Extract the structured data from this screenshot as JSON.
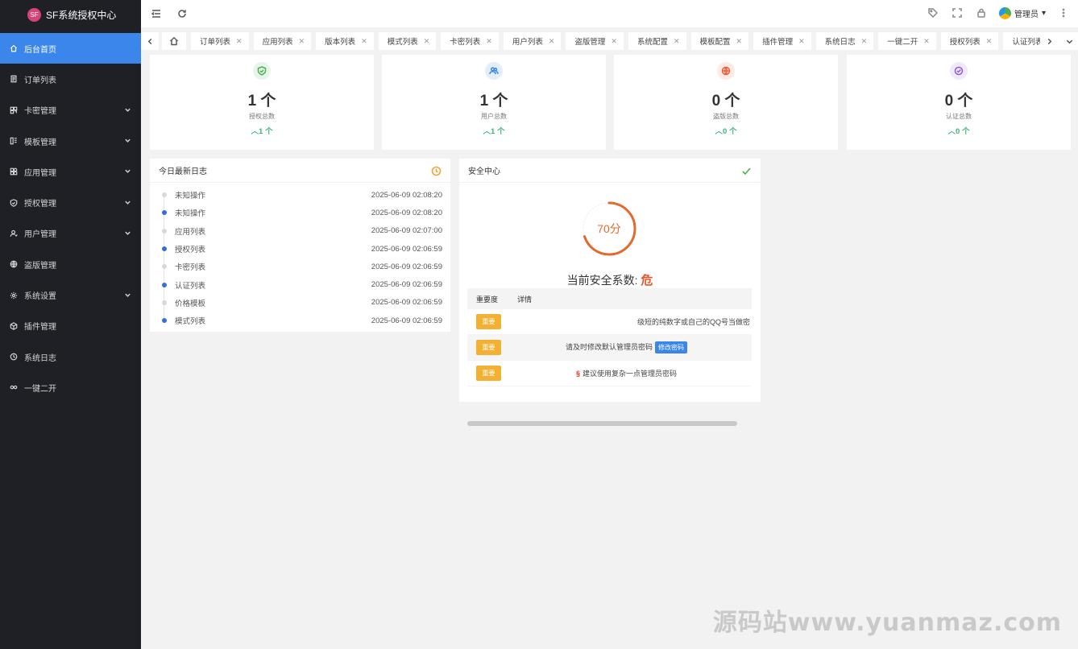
{
  "app": {
    "title": "SF系统授权中心",
    "logo_text": "SF"
  },
  "sidebar": {
    "items": [
      {
        "label": "后台首页",
        "icon": "home-icon",
        "active": true,
        "has_children": false
      },
      {
        "label": "订单列表",
        "icon": "list-icon",
        "active": false,
        "has_children": false
      },
      {
        "label": "卡密管理",
        "icon": "card-icon",
        "active": false,
        "has_children": true
      },
      {
        "label": "模板管理",
        "icon": "template-icon",
        "active": false,
        "has_children": true
      },
      {
        "label": "应用管理",
        "icon": "app-icon",
        "active": false,
        "has_children": true
      },
      {
        "label": "授权管理",
        "icon": "shield-icon",
        "active": false,
        "has_children": true
      },
      {
        "label": "用户管理",
        "icon": "user-icon",
        "active": false,
        "has_children": true
      },
      {
        "label": "盗版管理",
        "icon": "globe-icon",
        "active": false,
        "has_children": false
      },
      {
        "label": "系统设置",
        "icon": "gear-icon",
        "active": false,
        "has_children": true
      },
      {
        "label": "插件管理",
        "icon": "plugin-icon",
        "active": false,
        "has_children": false
      },
      {
        "label": "系统日志",
        "icon": "clock-icon",
        "active": false,
        "has_children": false
      },
      {
        "label": "一键二开",
        "icon": "link-icon",
        "active": false,
        "has_children": false
      }
    ]
  },
  "topbar": {
    "user_label": "管理员"
  },
  "tabs": [
    "订单列表",
    "应用列表",
    "版本列表",
    "模式列表",
    "卡密列表",
    "用户列表",
    "盗版管理",
    "系统配置",
    "模板配置",
    "插件管理",
    "系统日志",
    "一键二开",
    "授权列表",
    "认证列表"
  ],
  "stats": [
    {
      "value": "1 个",
      "label": "授权总数",
      "trend": "1 个",
      "icon": "shield-check-icon",
      "color": "#4caf50",
      "bg": "#e8f6ea"
    },
    {
      "value": "1 个",
      "label": "用户总数",
      "trend": "1 个",
      "icon": "users-icon",
      "color": "#3a86ea",
      "bg": "#e3eefc"
    },
    {
      "value": "0 个",
      "label": "盗版总数",
      "trend": "0 个",
      "icon": "globe-icon",
      "color": "#e8603c",
      "bg": "#fdeae4"
    },
    {
      "value": "0 个",
      "label": "认证总数",
      "trend": "0 个",
      "icon": "check-circle-icon",
      "color": "#8e5ad8",
      "bg": "#f1e9fb"
    }
  ],
  "log_panel": {
    "title": "今日最新日志",
    "rows": [
      {
        "text": "未知操作",
        "time": "2025-06-09 02:08:20",
        "highlight": false
      },
      {
        "text": "未知操作",
        "time": "2025-06-09 02:08:20",
        "highlight": true
      },
      {
        "text": "应用列表",
        "time": "2025-06-09 02:07:00",
        "highlight": false
      },
      {
        "text": "授权列表",
        "time": "2025-06-09 02:06:59",
        "highlight": true
      },
      {
        "text": "卡密列表",
        "time": "2025-06-09 02:06:59",
        "highlight": false
      },
      {
        "text": "认证列表",
        "time": "2025-06-09 02:06:59",
        "highlight": true
      },
      {
        "text": "价格模板",
        "time": "2025-06-09 02:06:59",
        "highlight": false
      },
      {
        "text": "模式列表",
        "time": "2025-06-09 02:06:59",
        "highlight": true
      }
    ]
  },
  "security": {
    "title": "安全中心",
    "score": "70分",
    "score_fraction": 0.7,
    "coefficient_label": "当前安全系数:",
    "coefficient_value": "危",
    "headers": [
      "重要度",
      "详情"
    ],
    "rows": [
      {
        "level": "重要",
        "detail": "级短的纯数字或自己的QQ号当做密",
        "button": ""
      },
      {
        "level": "重要",
        "detail": "请及时修改默认管理员密码",
        "button": "修改密码"
      },
      {
        "level": "重要",
        "detail": "建议使用复杂一点管理员密码",
        "button": ""
      }
    ]
  },
  "watermark": "源码站www.yuanmaz.com"
}
